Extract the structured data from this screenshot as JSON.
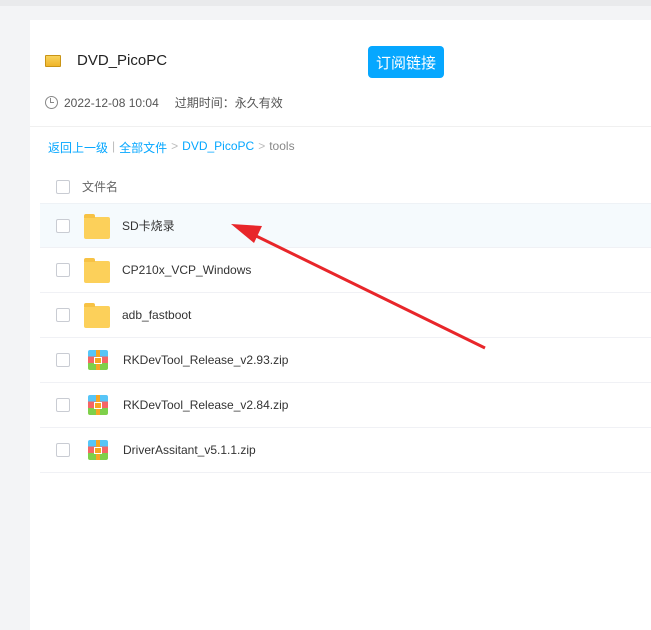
{
  "share": {
    "title": "DVD_PicoPC",
    "subscribe_label": "订阅链接",
    "date": "2022-12-08 10:04",
    "expire": "过期时间：永久有效"
  },
  "breadcrumb": {
    "back": "返回上一级",
    "sep": "|",
    "all": "全部文件",
    "gt": ">",
    "folder": "DVD_PicoPC",
    "current": "tools"
  },
  "table": {
    "header": "文件名"
  },
  "files": [
    {
      "name": "SD卡烧录",
      "type": "folder"
    },
    {
      "name": "CP210x_VCP_Windows",
      "type": "folder"
    },
    {
      "name": "adb_fastboot",
      "type": "folder"
    },
    {
      "name": "RKDevTool_Release_v2.93.zip",
      "type": "zip"
    },
    {
      "name": "RKDevTool_Release_v2.84.zip",
      "type": "zip"
    },
    {
      "name": "DriverAssitant_v5.1.1.zip",
      "type": "zip"
    }
  ],
  "colors": {
    "accent": "#06a7ff",
    "arrow": "#e8262a"
  }
}
